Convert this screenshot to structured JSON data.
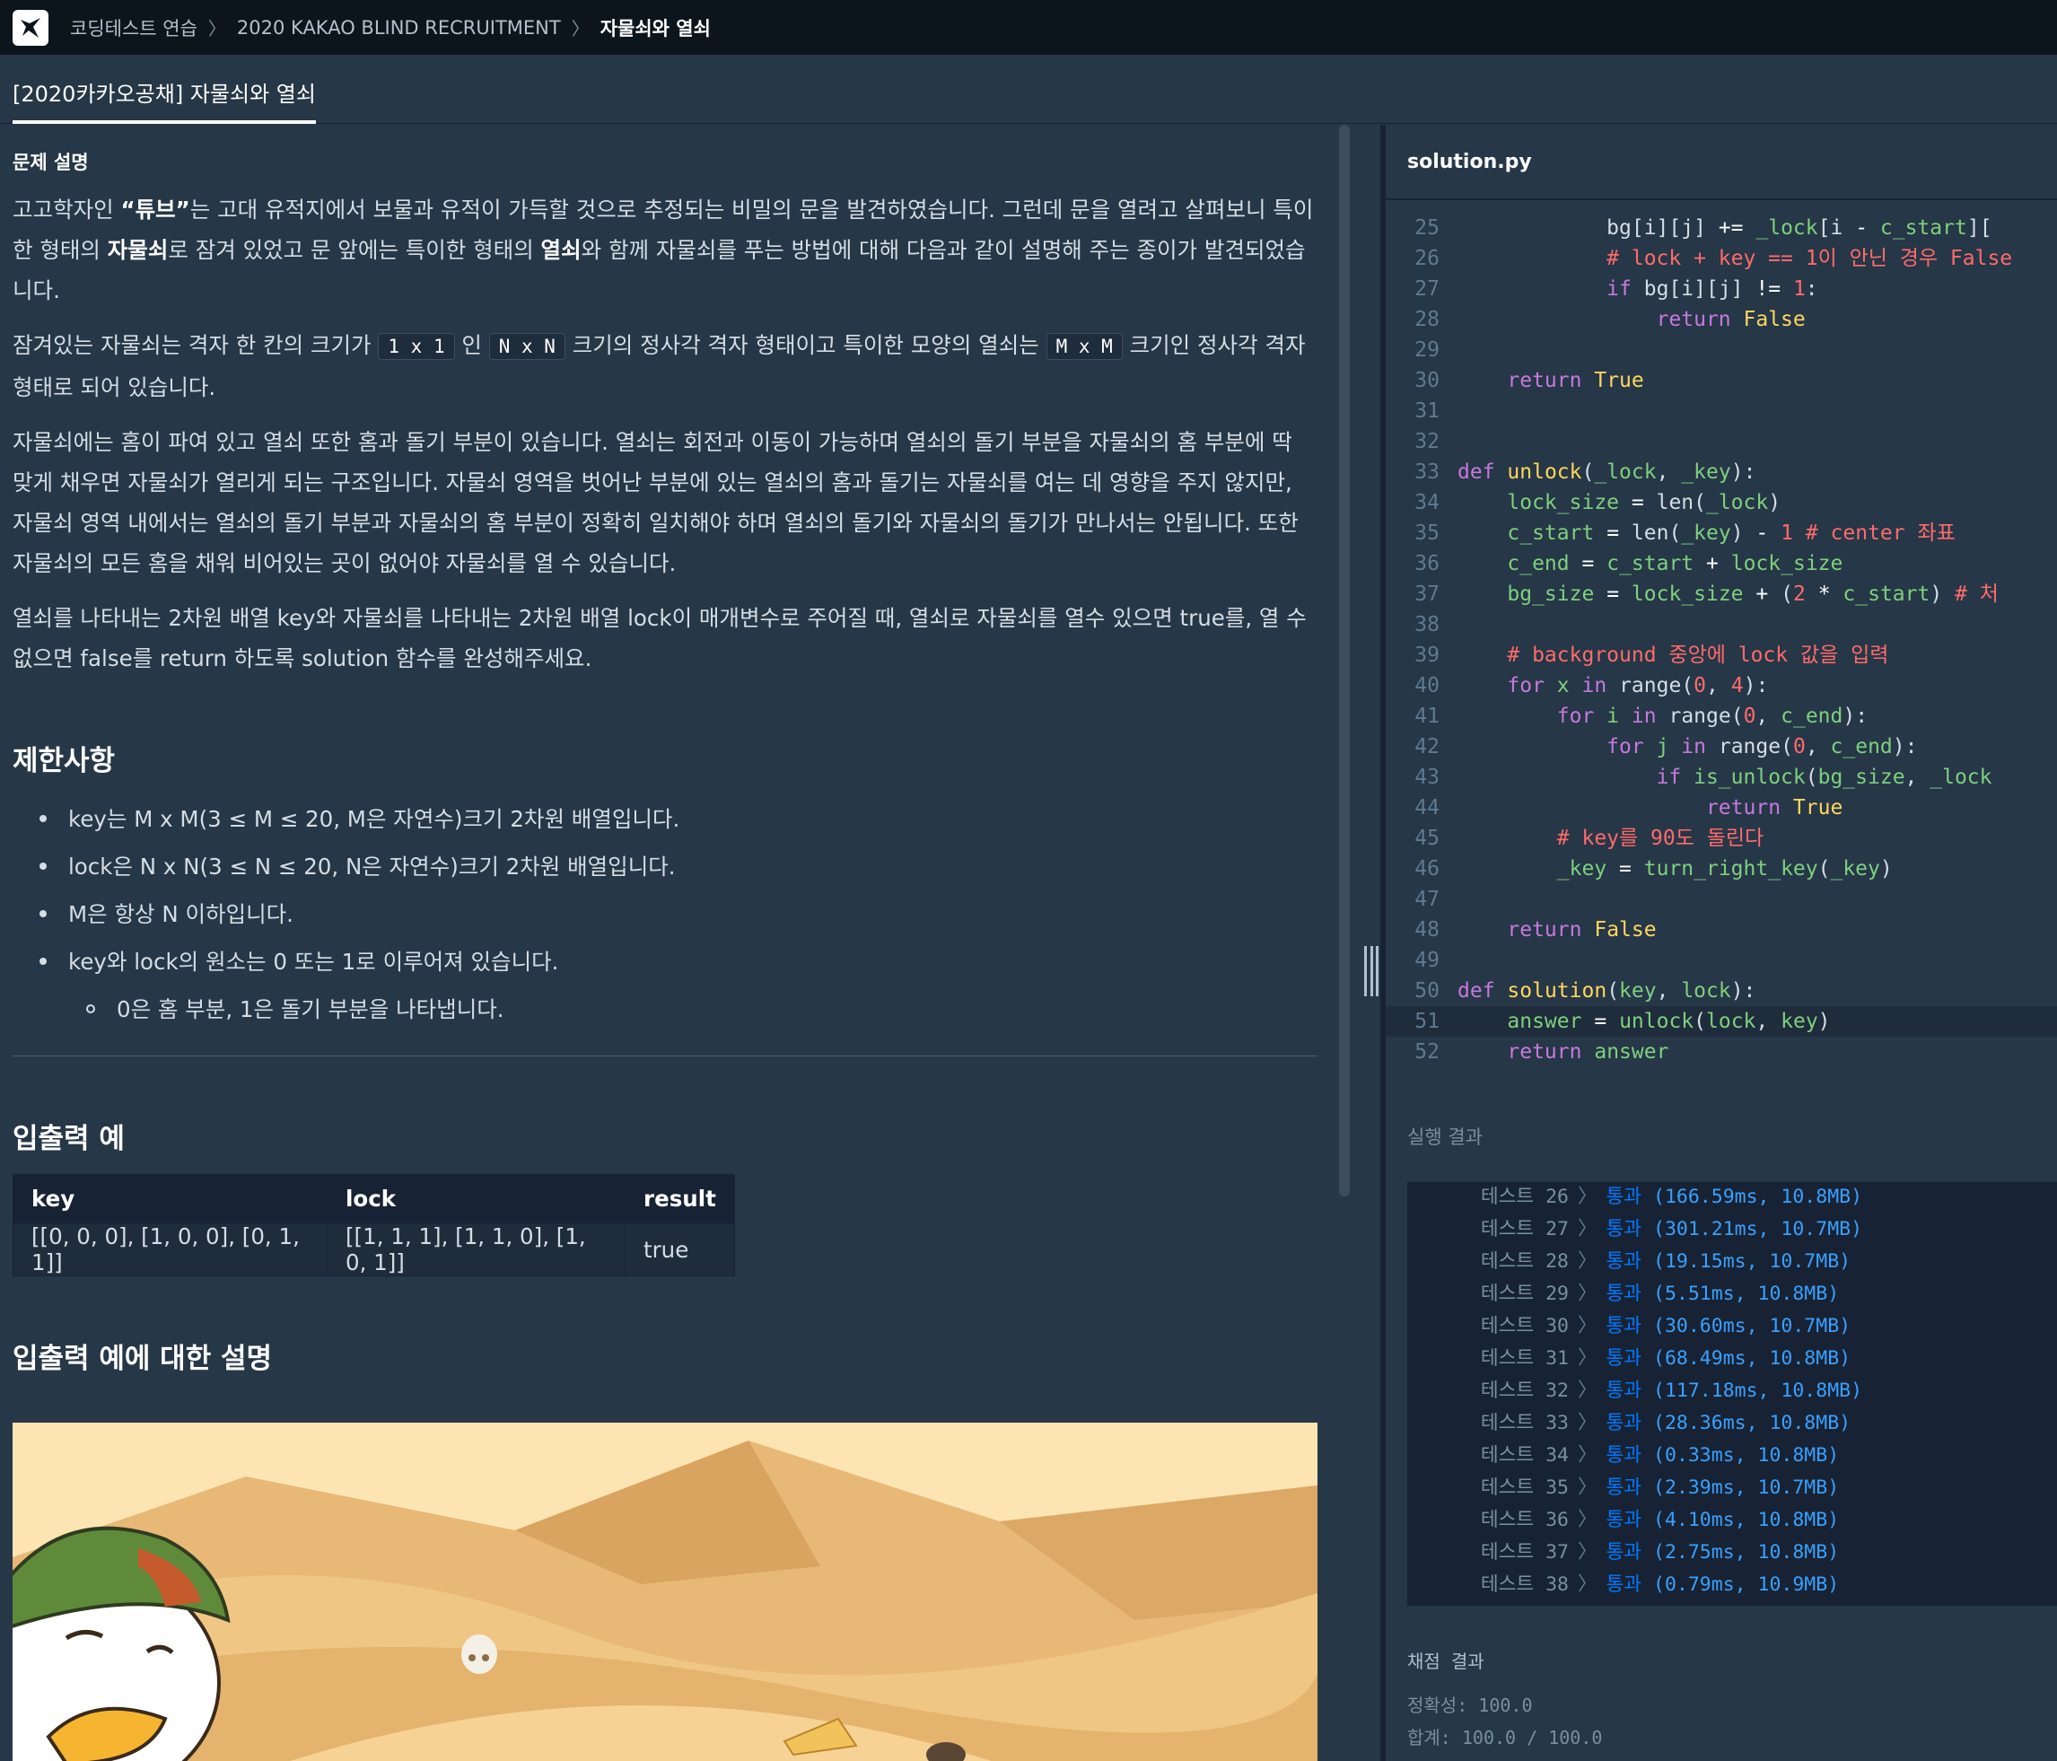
{
  "breadcrumb": {
    "items": [
      "코딩테스트 연습",
      "2020 KAKAO BLIND RECRUITMENT",
      "자물쇠와 열쇠"
    ]
  },
  "tab": {
    "label": "[2020카카오공채] 자물쇠와 열쇠"
  },
  "problem": {
    "section_label": "문제 설명",
    "p1_part1": "고고학자인 ",
    "p1_quote": "“튜브”",
    "p1_part2": "는 고대 유적지에서 보물과 유적이 가득할 것으로 추정되는 비밀의 문을 발견하였습니다. 그런데 문을 열려고 살펴보니 특이한 형태의 ",
    "p1_bold1": "자물쇠",
    "p1_part3": "로 잠겨 있었고 문 앞에는 특이한 형태의 ",
    "p1_bold2": "열쇠",
    "p1_part4": "와 함께 자물쇠를 푸는 방법에 대해 다음과 같이 설명해 주는 종이가 발견되었습니다.",
    "p2_a": "잠겨있는 자물쇠는 격자 한 칸의 크기가 ",
    "p2_code1": "1 x 1",
    "p2_b": " 인 ",
    "p2_code2": "N x N",
    "p2_c": " 크기의 정사각 격자 형태이고 특이한 모양의 열쇠는 ",
    "p2_code3": "M x M",
    "p2_d": " 크기인 정사각 격자 형태로 되어 있습니다.",
    "p3": "자물쇠에는 홈이 파여 있고 열쇠 또한 홈과 돌기 부분이 있습니다. 열쇠는 회전과 이동이 가능하며 열쇠의 돌기 부분을 자물쇠의 홈 부분에 딱 맞게 채우면 자물쇠가 열리게 되는 구조입니다. 자물쇠 영역을 벗어난 부분에 있는 열쇠의 홈과 돌기는 자물쇠를 여는 데 영향을 주지 않지만, 자물쇠 영역 내에서는 열쇠의 돌기 부분과 자물쇠의 홈 부분이 정확히 일치해야 하며 열쇠의 돌기와 자물쇠의 돌기가 만나서는 안됩니다. 또한 자물쇠의 모든 홈을 채워 비어있는 곳이 없어야 자물쇠를 열 수 있습니다.",
    "p4": "열쇠를 나타내는 2차원 배열 key와 자물쇠를 나타내는 2차원 배열 lock이 매개변수로 주어질 때, 열쇠로 자물쇠를 열수 있으면 true를, 열 수 없으면 false를 return 하도록 solution 함수를 완성해주세요.",
    "constraints_title": "제한사항",
    "constraints": [
      "key는 M x M(3 ≤ M ≤ 20, M은 자연수)크기 2차원 배열입니다.",
      "lock은 N x N(3 ≤ N ≤ 20, N은 자연수)크기 2차원 배열입니다.",
      "M은 항상 N 이하입니다.",
      "key와 lock의 원소는 0 또는 1로 이루어져 있습니다."
    ],
    "sub_constraint": "0은 홈 부분, 1은 돌기 부분을 나타냅니다.",
    "io_title": "입출력 예",
    "io_table": {
      "headers": [
        "key",
        "lock",
        "result"
      ],
      "row": [
        "[[0, 0, 0], [1, 0, 0], [0, 1, 1]]",
        "[[1, 1, 1], [1, 1, 0], [1, 0, 1]]",
        "true"
      ]
    },
    "io_explain_title": "입출력 예에 대한 설명"
  },
  "editor": {
    "filename": "solution.py",
    "lines": [
      {
        "n": "25",
        "html": "            <span class='tx'>bg[i][j]</span> <span class='op'>+=</span> <span class='var'>_lock</span><span class='tx'>[i</span> <span class='op'>-</span> <span class='var'>c_start</span><span class='tx'>][</span>"
      },
      {
        "n": "26",
        "html": "            <span class='cm'># lock + key == 1이 안닌 경우 False</span>"
      },
      {
        "n": "27",
        "html": "            <span class='kw'>if</span> <span class='tx'>bg[i][j]</span> <span class='op'>!=</span> <span class='num'>1</span><span class='tx'>:</span>"
      },
      {
        "n": "28",
        "html": "                <span class='kw'>return</span> <span class='bi'>False</span>"
      },
      {
        "n": "29",
        "html": ""
      },
      {
        "n": "30",
        "html": "    <span class='kw'>return</span> <span class='bi'>True</span>"
      },
      {
        "n": "31",
        "html": ""
      },
      {
        "n": "32",
        "html": ""
      },
      {
        "n": "33",
        "html": "<span class='kw'>def</span> <span class='fn'>unlock</span><span class='tx'>(</span><span class='var'>_lock</span><span class='tx'>,</span> <span class='var'>_key</span><span class='tx'>):</span>"
      },
      {
        "n": "34",
        "html": "    <span class='var'>lock_size</span> <span class='op'>=</span> <span class='tx'>len(</span><span class='var'>_lock</span><span class='tx'>)</span>"
      },
      {
        "n": "35",
        "html": "    <span class='var'>c_start</span> <span class='op'>=</span> <span class='tx'>len(</span><span class='var'>_key</span><span class='tx'>)</span> <span class='op'>-</span> <span class='num'>1</span> <span class='cm'># center 좌표</span>"
      },
      {
        "n": "36",
        "html": "    <span class='var'>c_end</span> <span class='op'>=</span> <span class='var'>c_start</span> <span class='op'>+</span> <span class='var'>lock_size</span>"
      },
      {
        "n": "37",
        "html": "    <span class='var'>bg_size</span> <span class='op'>=</span> <span class='var'>lock_size</span> <span class='op'>+</span> <span class='tx'>(</span><span class='num'>2</span> <span class='op'>*</span> <span class='var'>c_start</span><span class='tx'>)</span> <span class='cm'># 처</span>"
      },
      {
        "n": "38",
        "html": ""
      },
      {
        "n": "39",
        "html": "    <span class='cm'># background 중앙에 lock 값을 입력</span>"
      },
      {
        "n": "40",
        "html": "    <span class='kw'>for</span> <span class='var'>x</span> <span class='kw'>in</span> <span class='tx'>range(</span><span class='num'>0</span><span class='tx'>,</span> <span class='num'>4</span><span class='tx'>):</span>"
      },
      {
        "n": "41",
        "html": "        <span class='kw'>for</span> <span class='var'>i</span> <span class='kw'>in</span> <span class='tx'>range(</span><span class='num'>0</span><span class='tx'>,</span> <span class='var'>c_end</span><span class='tx'>):</span>"
      },
      {
        "n": "42",
        "html": "            <span class='kw'>for</span> <span class='var'>j</span> <span class='kw'>in</span> <span class='tx'>range(</span><span class='num'>0</span><span class='tx'>,</span> <span class='var'>c_end</span><span class='tx'>):</span>"
      },
      {
        "n": "43",
        "html": "                <span class='kw'>if</span> <span class='var'>is_unlock</span><span class='tx'>(</span><span class='var'>bg_size</span><span class='tx'>,</span> <span class='var'>_lock</span>"
      },
      {
        "n": "44",
        "html": "                    <span class='kw'>return</span> <span class='bi'>True</span>"
      },
      {
        "n": "45",
        "html": "        <span class='cm'># key를 90도 돌린다</span>"
      },
      {
        "n": "46",
        "html": "        <span class='var'>_key</span> <span class='op'>=</span> <span class='var'>turn_right_key</span><span class='tx'>(</span><span class='var'>_key</span><span class='tx'>)</span>"
      },
      {
        "n": "47",
        "html": ""
      },
      {
        "n": "48",
        "html": "    <span class='kw'>return</span> <span class='bi'>False</span>"
      },
      {
        "n": "49",
        "html": ""
      },
      {
        "n": "50",
        "html": "<span class='kw'>def</span> <span class='fn'>solution</span><span class='tx'>(</span><span class='var'>key</span><span class='tx'>,</span> <span class='var'>lock</span><span class='tx'>):</span>"
      },
      {
        "n": "51",
        "html": "    <span class='var'>answer</span> <span class='op'>=</span> <span class='var'>unlock</span><span class='tx'>(</span><span class='var'>lock</span><span class='tx'>,</span> <span class='var'>key</span><span class='tx'>)</span>"
      },
      {
        "n": "52",
        "html": "    <span class='kw'>return</span> <span class='var'>answer</span>"
      }
    ]
  },
  "run": {
    "label": "실행 결과",
    "results": [
      {
        "label": "테스트 26",
        "status": "통과",
        "detail": "(166.59ms, 10.8MB)"
      },
      {
        "label": "테스트 27",
        "status": "통과",
        "detail": "(301.21ms, 10.7MB)"
      },
      {
        "label": "테스트 28",
        "status": "통과",
        "detail": "(19.15ms, 10.7MB)"
      },
      {
        "label": "테스트 29",
        "status": "통과",
        "detail": "(5.51ms, 10.8MB)"
      },
      {
        "label": "테스트 30",
        "status": "통과",
        "detail": "(30.60ms, 10.7MB)"
      },
      {
        "label": "테스트 31",
        "status": "통과",
        "detail": "(68.49ms, 10.8MB)"
      },
      {
        "label": "테스트 32",
        "status": "통과",
        "detail": "(117.18ms, 10.8MB)"
      },
      {
        "label": "테스트 33",
        "status": "통과",
        "detail": "(28.36ms, 10.8MB)"
      },
      {
        "label": "테스트 34",
        "status": "통과",
        "detail": "(0.33ms, 10.8MB)"
      },
      {
        "label": "테스트 35",
        "status": "통과",
        "detail": "(2.39ms, 10.7MB)"
      },
      {
        "label": "테스트 36",
        "status": "통과",
        "detail": "(4.10ms, 10.8MB)"
      },
      {
        "label": "테스트 37",
        "status": "통과",
        "detail": "(2.75ms, 10.8MB)"
      },
      {
        "label": "테스트 38",
        "status": "통과",
        "detail": "(0.79ms, 10.9MB)"
      }
    ]
  },
  "grade": {
    "title": "채점 결과",
    "accuracy": "정확성: 100.0",
    "total": "합계: 100.0 / 100.0"
  }
}
